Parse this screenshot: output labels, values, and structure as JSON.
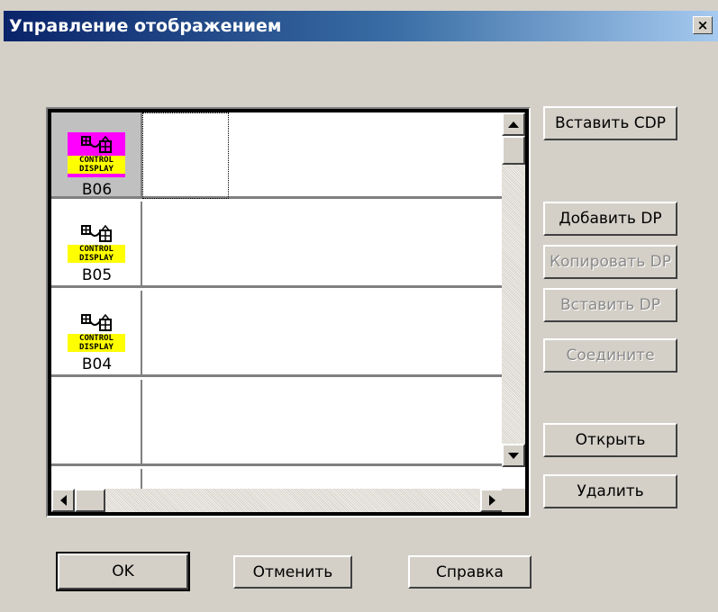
{
  "window": {
    "title": "Управление отображением",
    "close_label": "×"
  },
  "list": {
    "rows": [
      {
        "icon": "control-display-icon",
        "label_top": "CONTROL",
        "label_bottom": "DISPLAY",
        "code": "B06",
        "selected": true,
        "highlight_color": "#ff00ff"
      },
      {
        "icon": "control-display-icon",
        "label_top": "CONTROL",
        "label_bottom": "DISPLAY",
        "code": "B05",
        "selected": false
      },
      {
        "icon": "control-display-icon",
        "label_top": "CONTROL",
        "label_bottom": "DISPLAY",
        "code": "B04",
        "selected": false
      },
      {
        "icon": "",
        "code": ""
      },
      {
        "icon": "",
        "code": ""
      }
    ]
  },
  "side_buttons": {
    "insert_cdp": "Вставить CDP",
    "add_dp": "Добавить DP",
    "copy_dp": "Копировать DP",
    "paste_dp": "Вставить DP",
    "connect": "Соедините",
    "open": "Открыть",
    "delete": "Удалить"
  },
  "footer_buttons": {
    "ok": "OK",
    "cancel": "Отменить",
    "help": "Справка"
  },
  "colors": {
    "title_bar_start": "#0a246a",
    "title_bar_end": "#a6caf0",
    "label_yellow": "#ffff00",
    "selected_magenta": "#ff00ff",
    "disabled_text": "#8a8a8a"
  }
}
